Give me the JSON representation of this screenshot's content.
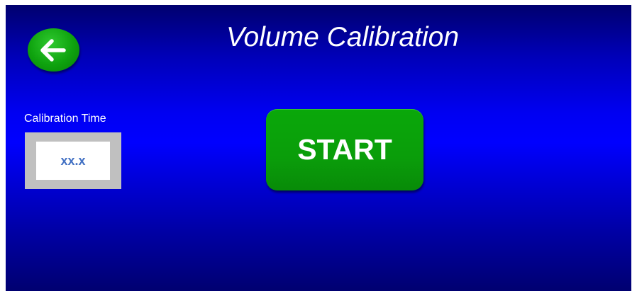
{
  "header": {
    "title": "Volume Calibration",
    "back_icon": "arrow-left-icon"
  },
  "calibration": {
    "label": "Calibration Time",
    "value": "xx.x"
  },
  "actions": {
    "start_label": "START"
  },
  "colors": {
    "background": "#0000ff",
    "button_green": "#0a9d0a",
    "value_text": "#4472c4",
    "field_frame": "#c0c0c0"
  }
}
